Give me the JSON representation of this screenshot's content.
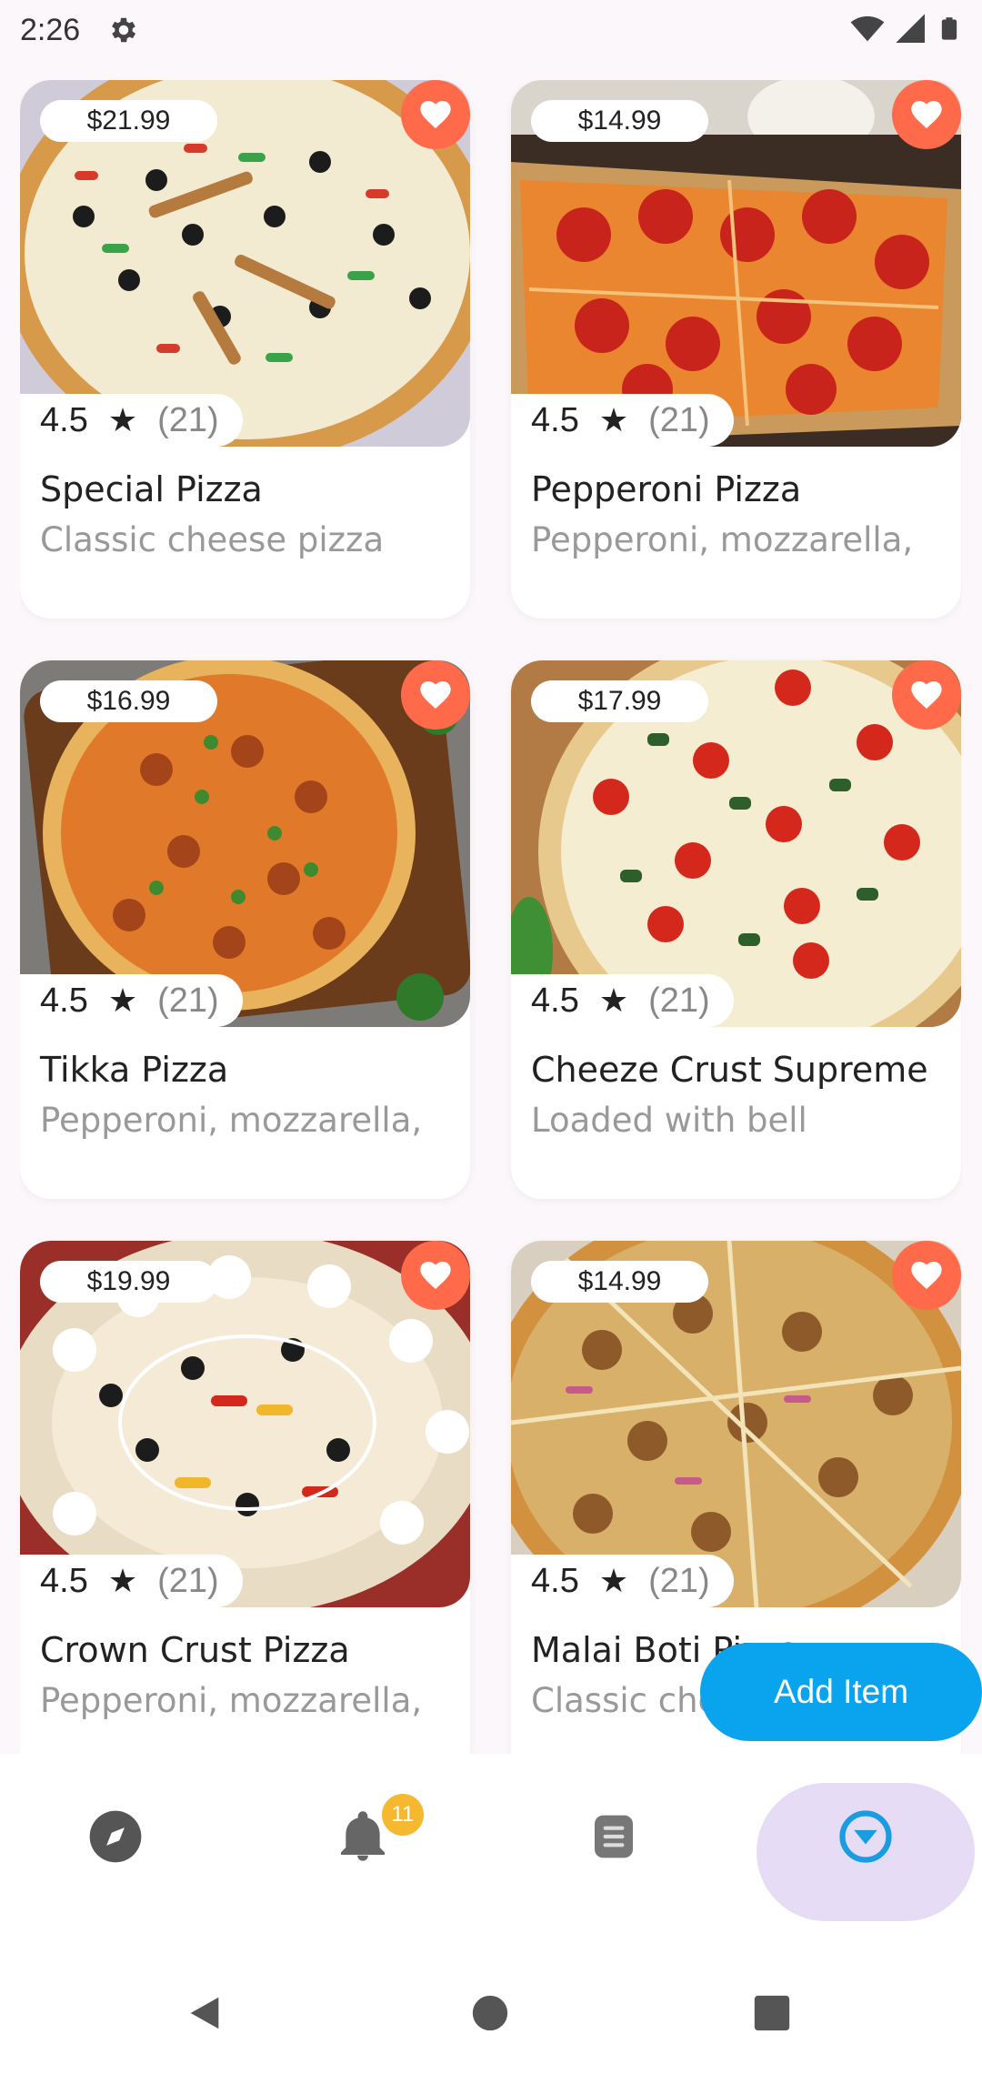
{
  "status_bar": {
    "time": "2:26"
  },
  "items": [
    {
      "price": "$21.99",
      "rating": "4.5",
      "reviews": "(21)",
      "name": "Special Pizza",
      "desc": "Classic cheese pizza"
    },
    {
      "price": "$14.99",
      "rating": "4.5",
      "reviews": "(21)",
      "name": "Pepperoni Pizza",
      "desc": "Pepperoni, mozzarella,"
    },
    {
      "price": "$16.99",
      "rating": "4.5",
      "reviews": "(21)",
      "name": "Tikka Pizza",
      "desc": "Pepperoni, mozzarella,"
    },
    {
      "price": "$17.99",
      "rating": "4.5",
      "reviews": "(21)",
      "name": "Cheeze Crust Supreme",
      "desc": "Loaded with bell"
    },
    {
      "price": "$19.99",
      "rating": "4.5",
      "reviews": "(21)",
      "name": "Crown Crust Pizza",
      "desc": "Pepperoni, mozzarella,"
    },
    {
      "price": "$14.99",
      "rating": "4.5",
      "reviews": "(21)",
      "name": "Malai Boti Pizza",
      "desc": "Classic cheese"
    }
  ],
  "fab": {
    "label": "Add Item"
  },
  "bottom_nav": {
    "items": [
      {
        "icon": "compass-icon"
      },
      {
        "icon": "bell-icon",
        "badge": "11"
      },
      {
        "icon": "list-icon"
      },
      {
        "icon": "chevron-down-circle-icon",
        "active": true
      }
    ]
  },
  "colors": {
    "accent": "#0aa4ee",
    "favorite": "#ff6b4a",
    "badge": "#f5b82e",
    "active_nav": "#e7dcf5"
  }
}
